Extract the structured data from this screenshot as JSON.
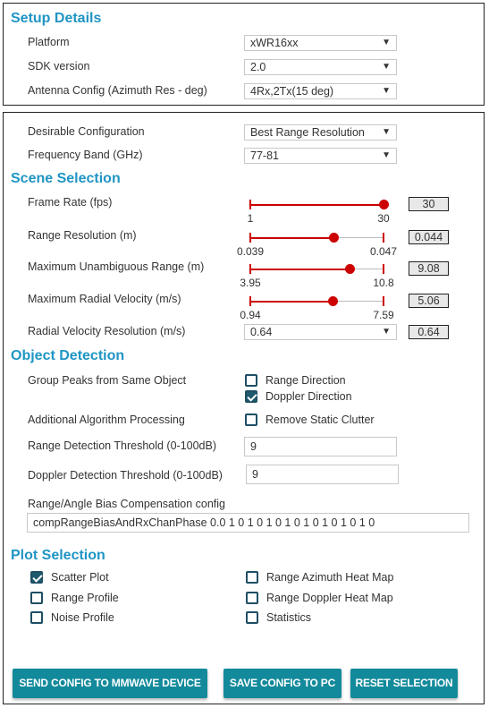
{
  "setup": {
    "title": "Setup Details",
    "platform_label": "Platform",
    "platform": "xWR16xx",
    "sdk_label": "SDK version",
    "sdk": "2.0",
    "antenna_label": "Antenna Config (Azimuth Res - deg)",
    "antenna": "4Rx,2Tx(15 deg)"
  },
  "config": {
    "desirable_label": "Desirable Configuration",
    "desirable": "Best Range Resolution",
    "band_label": "Frequency Band (GHz)",
    "band": "77-81"
  },
  "scene": {
    "title": "Scene Selection",
    "sliders": [
      {
        "label": "Frame Rate (fps)",
        "min": 1,
        "max": 30,
        "value": 30,
        "min_label": "1",
        "max_label": "30",
        "value_label": "30"
      },
      {
        "label": "Range Resolution (m)",
        "min": 0.039,
        "max": 0.047,
        "value": 0.044,
        "min_label": "0.039",
        "max_label": "0.047",
        "value_label": "0.044"
      },
      {
        "label": "Maximum Unambiguous Range (m)",
        "min": 3.95,
        "max": 10.8,
        "value": 9.08,
        "min_label": "3.95",
        "max_label": "10.8",
        "value_label": "9.08"
      },
      {
        "label": "Maximum Radial Velocity (m/s)",
        "min": 0.94,
        "max": 7.59,
        "value": 5.06,
        "min_label": "0.94",
        "max_label": "7.59",
        "value_label": "5.06"
      }
    ],
    "vel_res_label": "Radial Velocity Resolution (m/s)",
    "vel_res": "0.64",
    "vel_res_value": "0.64"
  },
  "object": {
    "title": "Object Detection",
    "group_label": "Group Peaks from Same Object",
    "range_dir": "Range Direction",
    "range_dir_checked": false,
    "doppler_dir": "Doppler Direction",
    "doppler_dir_checked": true,
    "algo_label": "Additional Algorithm Processing",
    "static_clutter": "Remove Static Clutter",
    "static_clutter_checked": false,
    "range_thresh_label": "Range Detection Threshold (0-100dB)",
    "range_thresh": "9",
    "doppler_thresh_label": "Doppler Detection Threshold (0-100dB)",
    "doppler_thresh": "9",
    "bias_label": "Range/Angle Bias Compensation config",
    "bias": "compRangeBiasAndRxChanPhase 0.0 1 0 1 0 1 0 1 0 1 0 1 0 1 0 1 0"
  },
  "plot": {
    "title": "Plot Selection",
    "items": [
      {
        "label": "Scatter Plot",
        "checked": true
      },
      {
        "label": "Range Azimuth Heat Map",
        "checked": false
      },
      {
        "label": "Range Profile",
        "checked": false
      },
      {
        "label": "Range Doppler Heat Map",
        "checked": false
      },
      {
        "label": "Noise Profile",
        "checked": false
      },
      {
        "label": "Statistics",
        "checked": false
      }
    ]
  },
  "buttons": {
    "send": "SEND CONFIG TO MMWAVE DEVICE",
    "save": "SAVE CONFIG TO PC",
    "reset": "RESET SELECTION"
  },
  "colors": {
    "heading": "#1f95c4",
    "slider": "#cc0000",
    "button": "#138a9b",
    "checkbox": "#1e5a6e"
  }
}
